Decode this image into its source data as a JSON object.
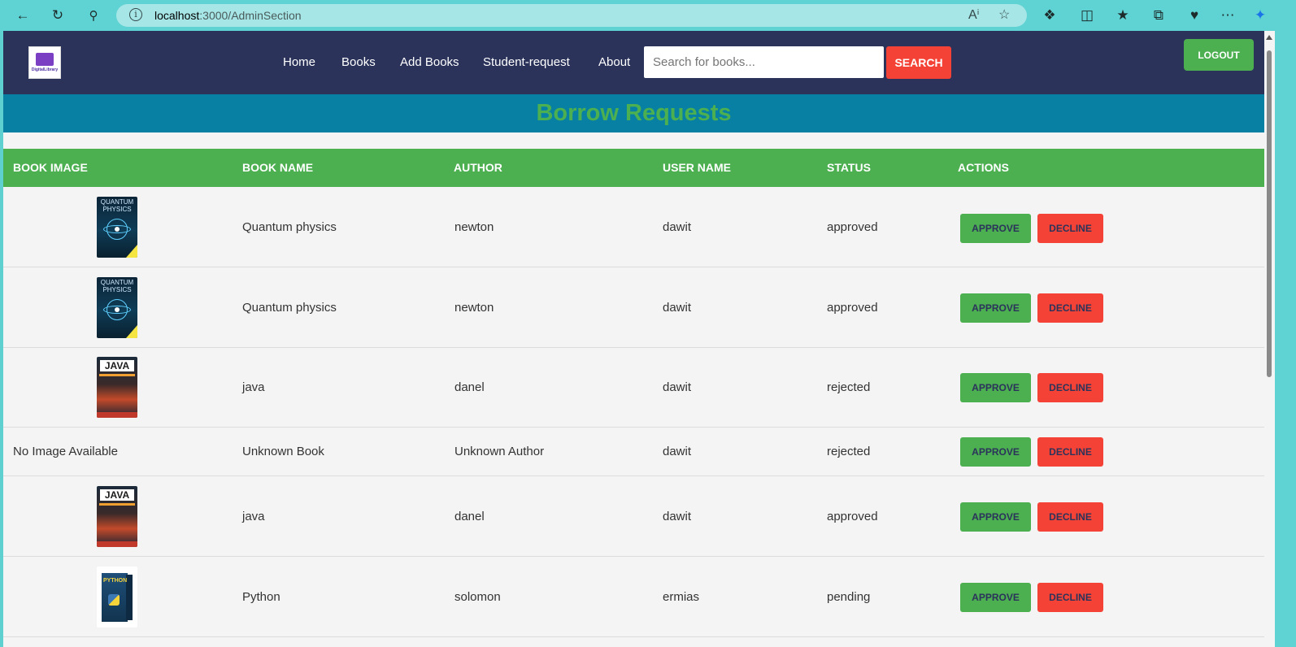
{
  "browser": {
    "url_host": "localhost",
    "url_path": ":3000/AdminSection"
  },
  "navbar": {
    "logo_text": "DigitalLibrary",
    "links": [
      "Home",
      "Books",
      "Add Books",
      "Student-request",
      "About"
    ],
    "search_placeholder": "Search for books...",
    "search_label": "SEARCH",
    "logout_label": "LOGOUT"
  },
  "page": {
    "title": "Borrow Requests"
  },
  "table": {
    "headers": [
      "BOOK IMAGE",
      "BOOK NAME",
      "AUTHOR",
      "USER NAME",
      "STATUS",
      "ACTIONS"
    ],
    "approve_label": "APPROVE",
    "decline_label": "DECLINE",
    "rows": [
      {
        "image": "quantum-cover",
        "image_text": "QUANTUM PHYSICS",
        "book": "Quantum physics",
        "author": "newton",
        "user": "dawit",
        "status": "approved"
      },
      {
        "image": "quantum-cover",
        "image_text": "QUANTUM PHYSICS",
        "book": "Quantum physics",
        "author": "newton",
        "user": "dawit",
        "status": "approved"
      },
      {
        "image": "java-cover",
        "image_text": "JAVA",
        "book": "java",
        "author": "danel",
        "user": "dawit",
        "status": "rejected"
      },
      {
        "image": "none",
        "image_text": "No Image Available",
        "book": "Unknown Book",
        "author": "Unknown Author",
        "user": "dawit",
        "status": "rejected"
      },
      {
        "image": "java-cover",
        "image_text": "JAVA",
        "book": "java",
        "author": "danel",
        "user": "dawit",
        "status": "approved"
      },
      {
        "image": "python-cover",
        "image_text": "PYTHON",
        "book": "Python",
        "author": "solomon",
        "user": "ermias",
        "status": "pending"
      }
    ]
  },
  "colors": {
    "navbar": "#2b335b",
    "banner": "#0880a3",
    "accent_green": "#4caf50",
    "danger_red": "#f44336"
  }
}
